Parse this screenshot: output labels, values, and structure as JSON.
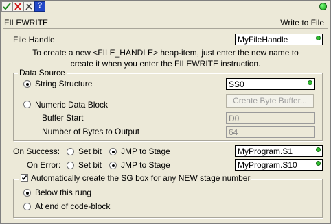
{
  "toolbar": {
    "ok_icon": "checkmark-icon",
    "cancel_icon": "x-icon",
    "tools_icon": "tools-icon",
    "help_icon": "question-icon",
    "help_label": "?",
    "status_color": "#18b818"
  },
  "header": {
    "title": "FILEWRITE",
    "subtitle": "Write to File"
  },
  "file_handle": {
    "label": "File Handle",
    "value": "MyFileHandle"
  },
  "hint": {
    "line1": "To create a new <FILE_HANDLE> heap-item, just enter the new name to",
    "line2": "create it when you enter the FILEWRITE instruction."
  },
  "data_source": {
    "legend": "Data Source",
    "string_structure_label": "String Structure",
    "string_structure_value": "SS0",
    "numeric_block_label": "Numeric Data Block",
    "create_buffer_label": "Create Byte Buffer...",
    "buffer_start_label": "Buffer Start",
    "buffer_start_value": "D0",
    "bytes_label": "Number of Bytes to Output",
    "bytes_value": "64",
    "selected": "String Structure"
  },
  "on_success": {
    "label": "On Success:",
    "opt_set_bit": "Set bit",
    "opt_jmp": "JMP to Stage",
    "value": "MyProgram.S1",
    "selected": "JMP to Stage"
  },
  "on_error": {
    "label": "On Error:",
    "opt_set_bit": "Set bit",
    "opt_jmp": "JMP to Stage",
    "value": "MyProgram.S10",
    "selected": "JMP to Stage"
  },
  "sg_box": {
    "checkbox_label": "Automatically create the SG box for any NEW stage number",
    "checked": true,
    "opt_below": "Below this rung",
    "opt_end": "At end of code-block",
    "selected": "Below this rung"
  }
}
